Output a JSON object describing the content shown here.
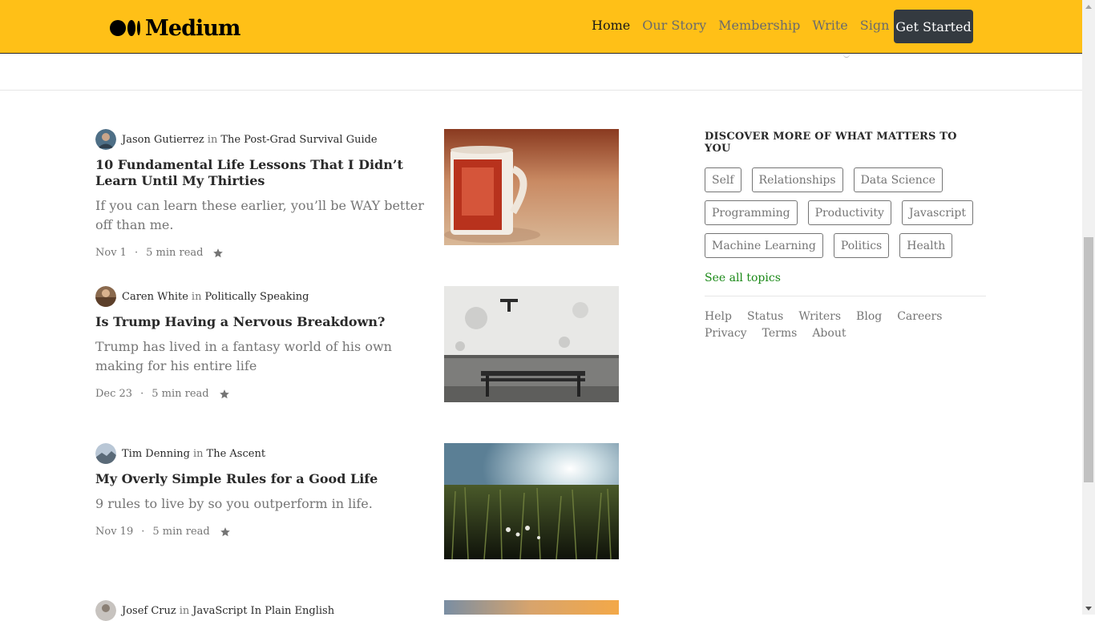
{
  "header": {
    "logo_text": "Medium",
    "nav": [
      {
        "label": "Home",
        "active": true
      },
      {
        "label": "Our Story",
        "active": false
      },
      {
        "label": "Membership",
        "active": false
      },
      {
        "label": "Write",
        "active": false
      },
      {
        "label": "Sign In",
        "active": false
      }
    ],
    "cta_label": "Get Started",
    "background_color": "#ffc017"
  },
  "articles": [
    {
      "author": "Jason Gutierrez",
      "in": "in",
      "publication": "The Post-Grad Survival Guide",
      "title": "10 Fundamental Life Lessons That I Didn’t Learn Until My Thirties",
      "subtitle": "If you can learn these earlier, you’ll be WAY better off than me.",
      "date": "Nov 1",
      "dot": "·",
      "read_time": "5 min read",
      "image": "red coffee mug"
    },
    {
      "author": "Caren White",
      "in": "in",
      "publication": "Politically Speaking",
      "title": "Is Trump Having a Nervous Breakdown?",
      "subtitle": "Trump has lived in a fantasy world of his own making for his entire life",
      "date": "Dec 23",
      "dot": "·",
      "read_time": "5 min read",
      "image": "bench against wall"
    },
    {
      "author": "Tim Denning",
      "in": "in",
      "publication": "The Ascent",
      "title": "My Overly Simple Rules for a Good Life",
      "subtitle": "9 rules to live by so you outperform in life.",
      "date": "Nov 19",
      "dot": "·",
      "read_time": "5 min read",
      "image": "sunlit grass field"
    },
    {
      "author": "Josef Cruz",
      "in": "in",
      "publication": "JavaScript In Plain English",
      "image": "sunset grass"
    }
  ],
  "sidebar": {
    "title": "DISCOVER MORE OF WHAT MATTERS TO YOU",
    "topics": [
      "Self",
      "Relationships",
      "Data Science",
      "Programming",
      "Productivity",
      "Javascript",
      "Machine Learning",
      "Politics",
      "Health"
    ],
    "see_all": "See all topics",
    "footer_links": [
      "Help",
      "Status",
      "Writers",
      "Blog",
      "Careers",
      "Privacy",
      "Terms",
      "About"
    ]
  },
  "icons": {
    "bookmark": "star-icon",
    "logo": "medium-logo-icon"
  }
}
